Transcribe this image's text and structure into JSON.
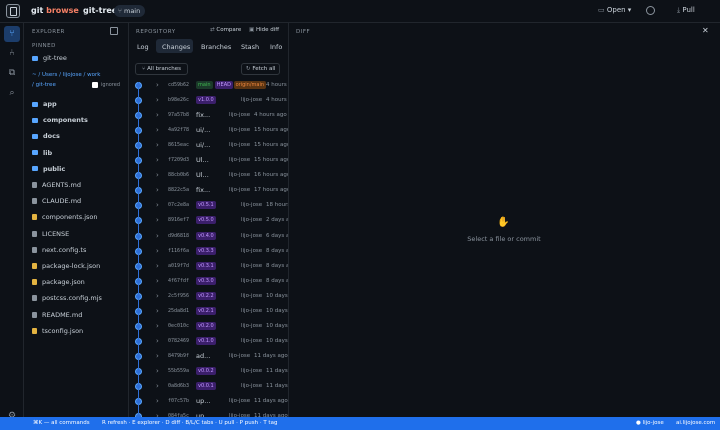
{
  "header": {
    "app_name_a": "git",
    "app_name_b": "browse",
    "repo": "git-tree",
    "branch": "main",
    "open_label": "Open",
    "pull_label": "Pull"
  },
  "explorer": {
    "title": "EXPLORER",
    "pinned_label": "PINNED",
    "pinned_item": "git-tree",
    "path": "~ / Users / lijojose / work",
    "path_tail": "/ git-tree",
    "ignored_label": "ignored",
    "items": [
      {
        "name": "app",
        "kind": "folder"
      },
      {
        "name": "components",
        "kind": "folder"
      },
      {
        "name": "docs",
        "kind": "folder"
      },
      {
        "name": "lib",
        "kind": "folder"
      },
      {
        "name": "public",
        "kind": "folder"
      },
      {
        "name": "AGENTS.md",
        "kind": "doc"
      },
      {
        "name": "CLAUDE.md",
        "kind": "doc"
      },
      {
        "name": "components.json",
        "kind": "json"
      },
      {
        "name": "LICENSE",
        "kind": "doc"
      },
      {
        "name": "next.config.ts",
        "kind": "doc"
      },
      {
        "name": "package-lock.json",
        "kind": "json"
      },
      {
        "name": "package.json",
        "kind": "json"
      },
      {
        "name": "postcss.config.mjs",
        "kind": "doc"
      },
      {
        "name": "README.md",
        "kind": "doc"
      },
      {
        "name": "tsconfig.json",
        "kind": "json"
      }
    ]
  },
  "repository": {
    "title": "REPOSITORY",
    "compare_label": "Compare",
    "hide_diff_label": "Hide diff",
    "tabs": [
      "Log",
      "Changes",
      "Branches",
      "Stash",
      "Info"
    ],
    "active_tab": "Changes",
    "all_branches_label": "All branches",
    "fetch_all_label": "Fetch all",
    "commits": [
      {
        "hash": "cd59b62",
        "tags": [
          "main",
          "HEAD",
          "origin/main"
        ],
        "msg": "",
        "author": "",
        "time": "4 hours a"
      },
      {
        "hash": "b98e26c",
        "tags": [
          "v1.0.0"
        ],
        "msg": "",
        "author": "lijo-jose",
        "time": "4 hours a"
      },
      {
        "hash": "97a57b8",
        "tags": [],
        "msg": "fix...",
        "author": "lijo-jose",
        "time": "4 hours ago"
      },
      {
        "hash": "4a92f78",
        "tags": [],
        "msg": "ui/...",
        "author": "lijo-jose",
        "time": "15 hours ago"
      },
      {
        "hash": "8615eac",
        "tags": [],
        "msg": "ui/...",
        "author": "lijo-jose",
        "time": "15 hours ago"
      },
      {
        "hash": "f7209d3",
        "tags": [],
        "msg": "Ul...",
        "author": "lijo-jose",
        "time": "15 hours ago"
      },
      {
        "hash": "88cb0b6",
        "tags": [],
        "msg": "Ul...",
        "author": "lijo-jose",
        "time": "16 hours ago"
      },
      {
        "hash": "8822c5a",
        "tags": [],
        "msg": "fix...",
        "author": "lijo-jose",
        "time": "17 hours ago"
      },
      {
        "hash": "07c2e8a",
        "tags": [
          "v0.5.1"
        ],
        "msg": "",
        "author": "lijo-jose",
        "time": "18 hours a"
      },
      {
        "hash": "8916ef7",
        "tags": [
          "v0.5.0"
        ],
        "msg": "",
        "author": "lijo-jose",
        "time": "2 days a"
      },
      {
        "hash": "d9d6818",
        "tags": [
          "v0.4.0"
        ],
        "msg": "",
        "author": "lijo-jose",
        "time": "6 days a"
      },
      {
        "hash": "f116f6a",
        "tags": [
          "v0.3.3"
        ],
        "msg": "",
        "author": "lijo-jose",
        "time": "8 days a"
      },
      {
        "hash": "a019f7d",
        "tags": [
          "v0.3.1"
        ],
        "msg": "",
        "author": "lijo-jose",
        "time": "8 days a"
      },
      {
        "hash": "4f67fdf",
        "tags": [
          "v0.3.0"
        ],
        "msg": "",
        "author": "lijo-jose",
        "time": "8 days a"
      },
      {
        "hash": "2c5f956",
        "tags": [
          "v0.2.2"
        ],
        "msg": "",
        "author": "lijo-jose",
        "time": "10 days a"
      },
      {
        "hash": "25da8d1",
        "tags": [
          "v0.2.1"
        ],
        "msg": "",
        "author": "lijo-jose",
        "time": "10 days a"
      },
      {
        "hash": "0ec010c",
        "tags": [
          "v0.2.0"
        ],
        "msg": "",
        "author": "lijo-jose",
        "time": "10 days a"
      },
      {
        "hash": "0782469",
        "tags": [
          "v0.1.0"
        ],
        "msg": "",
        "author": "lijo-jose",
        "time": "10 days a"
      },
      {
        "hash": "8479b9f",
        "tags": [],
        "msg": "ad...",
        "author": "lijo-jose",
        "time": "11 days ago"
      },
      {
        "hash": "55b559a",
        "tags": [
          "v0.0.2"
        ],
        "msg": "",
        "author": "lijo-jose",
        "time": "11 days a"
      },
      {
        "hash": "0a8d6b3",
        "tags": [
          "v0.0.1"
        ],
        "msg": "",
        "author": "lijo-jose",
        "time": "11 days a"
      },
      {
        "hash": "f07c57b",
        "tags": [],
        "msg": "up...",
        "author": "lijo-jose",
        "time": "11 days ago"
      },
      {
        "hash": "084fa5c",
        "tags": [],
        "msg": "up...",
        "author": "lijo-jose",
        "time": "11 days ago"
      }
    ]
  },
  "diff": {
    "title": "DIFF",
    "placeholder": "Select a file or commit"
  },
  "statusbar": {
    "commands": "⌘K — all commands",
    "shortcuts": "R refresh · E explorer · D diff · B/L/C tabs · U pull · P push · T tag",
    "user": "lijo-jose",
    "site": "ai.lijojose.com"
  },
  "colors": {
    "accent": "#1f6feb",
    "graph": "#2f6fd6",
    "tag_purple": "#c297ff",
    "tag_green": "#3fb950",
    "tag_orange": "#f0883e"
  }
}
